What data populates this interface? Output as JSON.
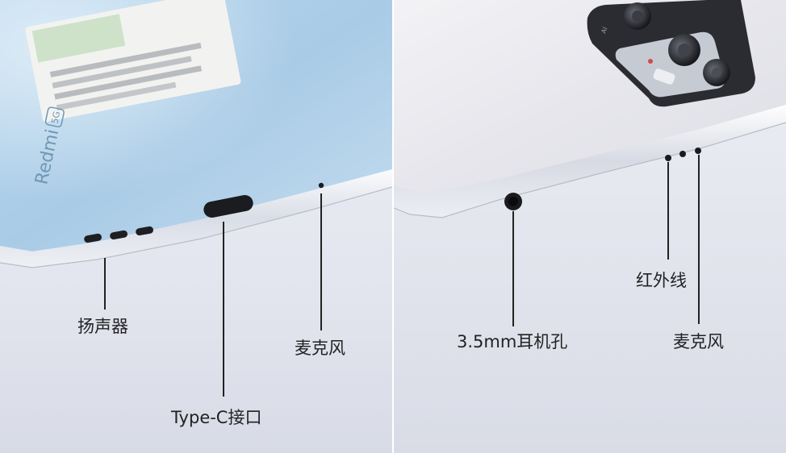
{
  "left_panel": {
    "brand_text": "Redmi",
    "brand_badge": "5G",
    "labels": {
      "speaker": "扬声器",
      "usb": "Type-C接口",
      "mic": "麦克风"
    }
  },
  "right_panel": {
    "camera_text": "AI",
    "labels": {
      "jack": "3.5mm耳机孔",
      "ir": "红外线",
      "mic": "麦克风"
    }
  }
}
